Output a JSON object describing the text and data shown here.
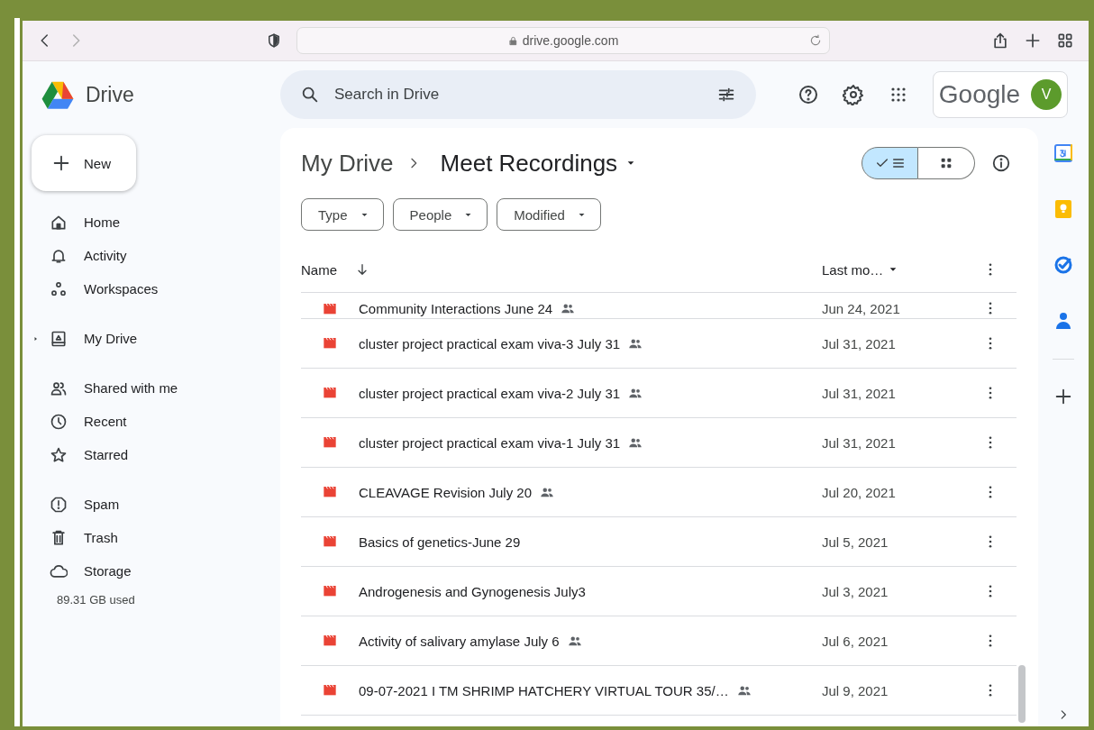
{
  "browser": {
    "url": "drive.google.com"
  },
  "app": {
    "name": "Drive",
    "search": {
      "placeholder": "Search in Drive"
    },
    "account": {
      "brand": "Google",
      "avatar": "V"
    }
  },
  "new_button": "New",
  "sidebar": {
    "groups": [
      [
        {
          "label": "Home",
          "expandable": false
        },
        {
          "label": "Activity",
          "expandable": false
        },
        {
          "label": "Workspaces",
          "expandable": false
        }
      ],
      [
        {
          "label": "My Drive",
          "expandable": true
        }
      ],
      [
        {
          "label": "Shared with me",
          "expandable": false
        },
        {
          "label": "Recent",
          "expandable": false
        },
        {
          "label": "Starred",
          "expandable": false
        }
      ],
      [
        {
          "label": "Spam",
          "expandable": false
        },
        {
          "label": "Trash",
          "expandable": false
        },
        {
          "label": "Storage",
          "expandable": false
        }
      ]
    ],
    "storage_used": "89.31 GB used"
  },
  "breadcrumb": [
    "My Drive",
    "Meet Recordings"
  ],
  "view_toggle": [
    {
      "kind": "list",
      "selected": true
    },
    {
      "kind": "grid",
      "selected": false
    }
  ],
  "filters": [
    "Type",
    "People",
    "Modified"
  ],
  "table": {
    "columns": [
      "Name",
      "Last mo…"
    ],
    "rows": [
      {
        "name": "Community Interactions June 24",
        "shared": true,
        "modified": "Jun 24, 2021"
      },
      {
        "name": "cluster project practical exam viva-3 July 31",
        "shared": true,
        "modified": "Jul 31, 2021"
      },
      {
        "name": "cluster project practical exam viva-2 July 31",
        "shared": true,
        "modified": "Jul 31, 2021"
      },
      {
        "name": "cluster project practical exam viva-1 July 31",
        "shared": true,
        "modified": "Jul 31, 2021"
      },
      {
        "name": "CLEAVAGE Revision July 20",
        "shared": true,
        "modified": "Jul 20, 2021"
      },
      {
        "name": "Basics of genetics-June 29",
        "shared": false,
        "modified": "Jul 5, 2021"
      },
      {
        "name": "Androgenesis and Gynogenesis July3",
        "shared": false,
        "modified": "Jul 3, 2021"
      },
      {
        "name": "Activity of salivary amylase July 6",
        "shared": true,
        "modified": "Jul 6, 2021"
      },
      {
        "name": "09-07-2021 I TM  SHRIMP HATCHERY VIRTUAL TOUR  35/…",
        "shared": true,
        "modified": "Jul 9, 2021"
      }
    ]
  }
}
